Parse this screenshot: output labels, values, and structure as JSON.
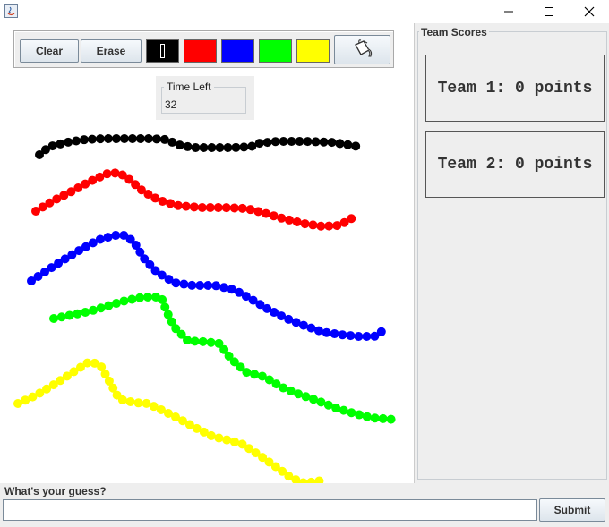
{
  "window": {
    "controls": {
      "minimize_icon": "minimize-icon",
      "maximize_icon": "maximize-icon",
      "close_icon": "close-icon"
    }
  },
  "toolbar": {
    "clear_label": "Clear",
    "erase_label": "Erase",
    "colors": [
      {
        "name": "black",
        "hex": "#000000",
        "selected": true
      },
      {
        "name": "red",
        "hex": "#ff0000",
        "selected": false
      },
      {
        "name": "blue",
        "hex": "#0000ff",
        "selected": false
      },
      {
        "name": "green",
        "hex": "#00ff00",
        "selected": false
      },
      {
        "name": "yellow",
        "hex": "#ffff00",
        "selected": false
      }
    ],
    "fill_tool_icon": "paint-bucket-icon"
  },
  "timer": {
    "label": "Time Left",
    "value": "32"
  },
  "scores": {
    "title": "Team Scores",
    "teams": [
      {
        "text": "Team 1: 0 points"
      },
      {
        "text": "Team 2: 0 points"
      }
    ]
  },
  "guess": {
    "label": "What's your guess?",
    "value": "",
    "submit_label": "Submit"
  }
}
